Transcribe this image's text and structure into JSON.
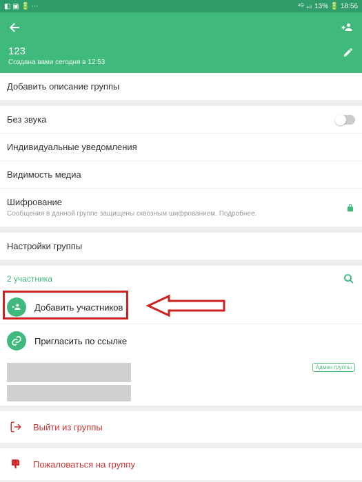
{
  "status": {
    "left_icons": "◧ ▣ 🔋 ⋯",
    "right_text": "13% 🔋 18:56",
    "signal": "⁴ᴳ ₊ᵢₗ"
  },
  "header": {
    "group_title": "123",
    "group_subtitle": "Создана вами сегодня в 12:53"
  },
  "sections": {
    "add_description": "Добавить описание группы",
    "mute": "Без звука",
    "individual_notifications": "Индивидуальные уведомления",
    "media_visibility": "Видимость медиа",
    "encryption_title": "Шифрование",
    "encryption_sub": "Сообщения в данной группе защищены сквозным шифрованием. Подробнее.",
    "group_settings": "Настройки группы"
  },
  "participants": {
    "count_label": "2 участника",
    "add_label": "Добавить участников",
    "invite_label": "Пригласить по ссылке",
    "admin_badge": "Админ группы"
  },
  "danger": {
    "exit": "Выйти из группы",
    "report": "Пожаловаться на группу"
  }
}
